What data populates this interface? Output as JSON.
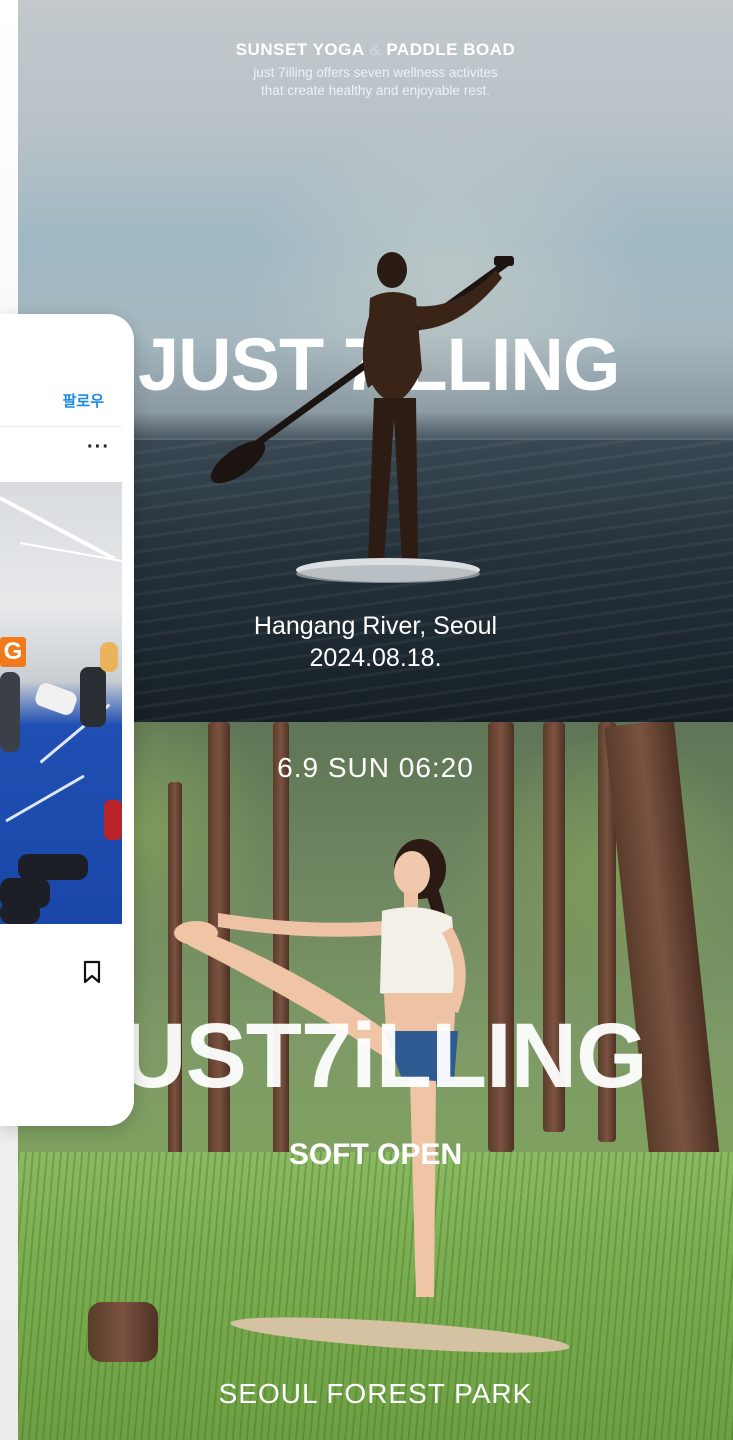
{
  "poster_top": {
    "title_left": "SUNSET YOGA",
    "title_amp": "&",
    "title_right": "PADDLE BOAD",
    "subtitle_line1": "just 7illing offers seven wellness activites",
    "subtitle_line2": "that create healthy and enjoyable rest.",
    "brand": "JUST 7iLLING",
    "location": "Hangang River, Seoul",
    "date": "2024.08.18."
  },
  "poster_bottom": {
    "datetime": "6.9 SUN 06:20",
    "brand": "UST7iLLING",
    "badge": "SOFT OPEN",
    "place": "SEOUL FOREST PARK"
  },
  "instagram_card": {
    "follow_label": "팔로우",
    "more_label": "···",
    "photo_overlay_letter": "G",
    "bookmark_icon": "bookmark-icon"
  },
  "colors": {
    "follow_blue": "#1c8be8",
    "accent_orange": "#f07a1c",
    "gym_floor_blue": "#1a47a8"
  }
}
